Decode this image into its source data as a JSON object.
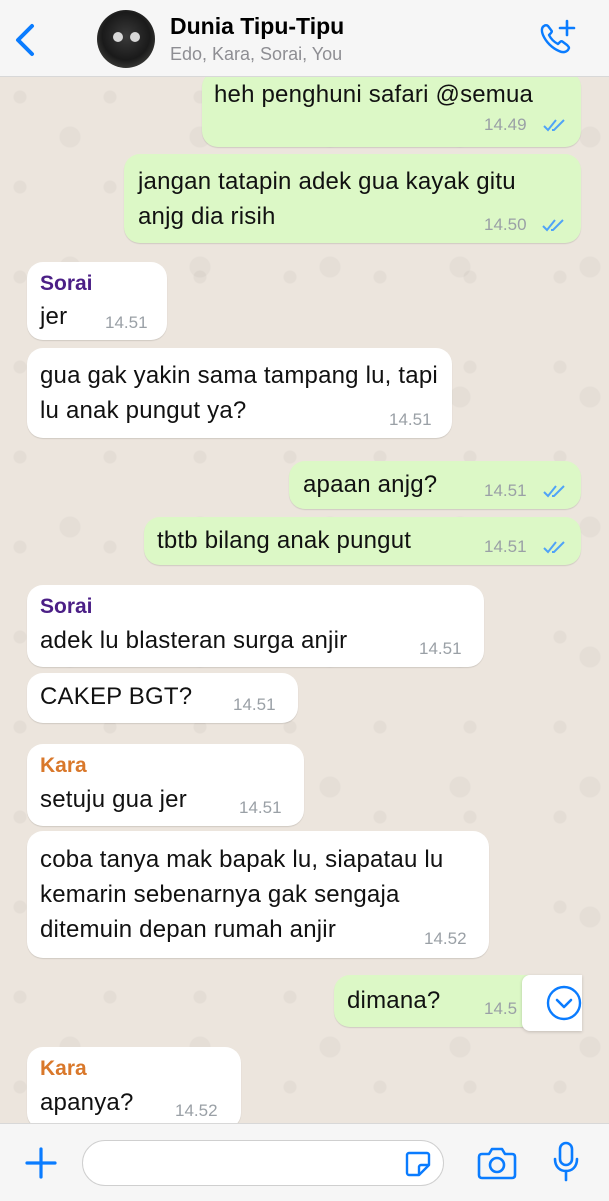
{
  "header": {
    "title": "Dunia Tipu-Tipu",
    "subtitle": "Edo, Kara, Sorai, You",
    "icons": [
      "back-chevron-icon",
      "group-avatar",
      "add-call-icon"
    ]
  },
  "colors": {
    "accent": "#0a7cff",
    "incoming": "#ffffff",
    "outgoing": "#dcf8c6",
    "sorai": "#4b1f86",
    "kara": "#d9782b",
    "ticks": "#4fa3f7"
  },
  "messages": [
    {
      "dir": "out",
      "text": "heh penghuni safari @semua",
      "time": "14.49"
    },
    {
      "dir": "out",
      "text": "jangan tatapin adek gua kayak gitu anjg dia risih",
      "time": "14.50"
    },
    {
      "dir": "in",
      "sender": "Sorai",
      "text": "jer",
      "time": "14.51"
    },
    {
      "dir": "in",
      "text": "gua gak yakin sama tampang lu, tapi lu anak pungut ya?",
      "time": "14.51"
    },
    {
      "dir": "out",
      "text": "apaan anjg?",
      "time": "14.51"
    },
    {
      "dir": "out",
      "text": "tbtb bilang anak pungut",
      "time": "14.51"
    },
    {
      "dir": "in",
      "sender": "Sorai",
      "text": "adek lu blasteran surga anjir",
      "time": "14.51"
    },
    {
      "dir": "in",
      "text": "CAKEP BGT?",
      "time": "14.51"
    },
    {
      "dir": "in",
      "sender": "Kara",
      "text": "setuju gua jer",
      "time": "14.51"
    },
    {
      "dir": "in",
      "text": "coba tanya mak bapak lu, siapatau lu kemarin sebenarnya gak sengaja ditemuin depan rumah anjir",
      "time": "14.52"
    },
    {
      "dir": "out",
      "text": "dimana?",
      "time": "14.5"
    },
    {
      "dir": "in",
      "sender": "Kara",
      "text": "apanya?",
      "time": "14.52"
    }
  ],
  "footer": {
    "icons": [
      "plus-icon",
      "sticker-icon",
      "camera-icon",
      "microphone-icon"
    ],
    "input_value": ""
  }
}
